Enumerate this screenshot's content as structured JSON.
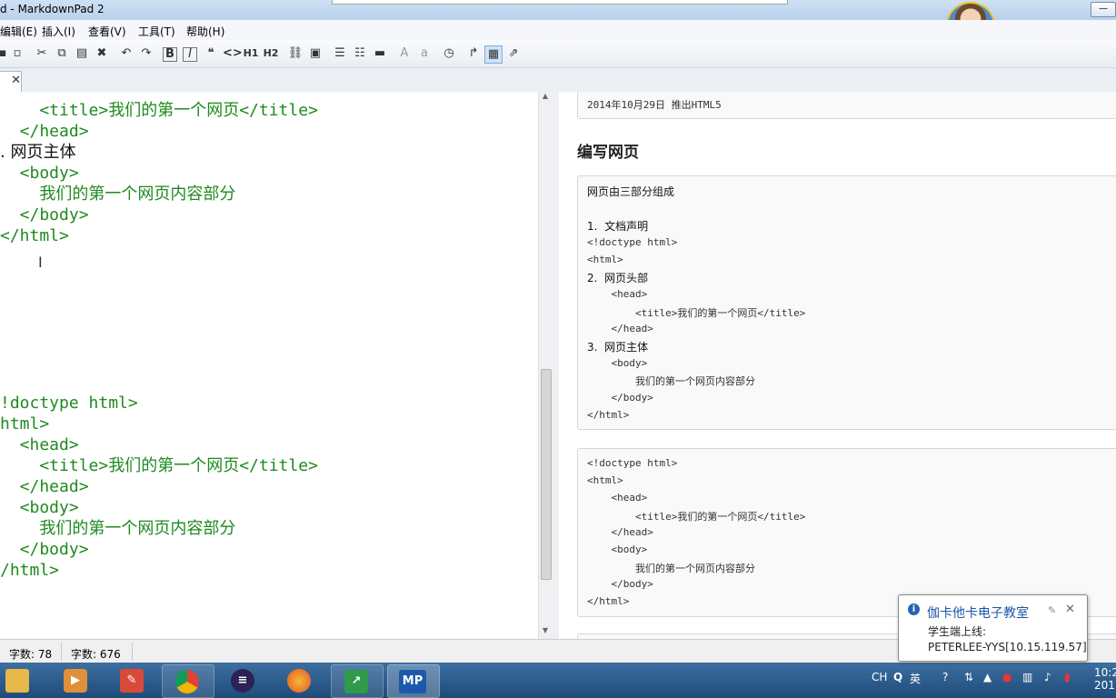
{
  "window": {
    "title": "d - MarkdownPad 2"
  },
  "menu": [
    "编辑(E)",
    "插入(I)",
    "查看(V)",
    "工具(T)",
    "帮助(H)"
  ],
  "toolbar": {
    "icons": [
      "save-icon",
      "save-all-icon",
      "cut-icon",
      "copy-icon",
      "paste-icon",
      "delete-icon",
      "undo-icon",
      "redo-icon",
      "bold-icon",
      "italic-icon",
      "quote-icon",
      "code-icon",
      "h1-icon",
      "h2-icon",
      "link-icon",
      "image-icon",
      "unordered-list-icon",
      "ordered-list-icon",
      "horizontal-rule-icon",
      "uppercase-icon",
      "lowercase-icon",
      "timestamp-icon",
      "export-icon",
      "live-preview-icon",
      "publish-icon"
    ],
    "labels": {
      "bold": "B",
      "italic": "I",
      "quote": "❝",
      "code": "<>",
      "h1": "H1",
      "h2": "H2",
      "upper": "A",
      "lower": "a"
    }
  },
  "tab": {
    "close": "✕"
  },
  "editor": {
    "lines": [
      "    <title>我们的第一个网页</title>",
      "  </head>",
      ". 网页主体",
      "  <body>",
      "    我们的第一个网页内容部分",
      "  </body>",
      "</html>",
      "!doctype html>",
      "html>",
      "  <head>",
      "    <title>我们的第一个网页</title>",
      "  </head>",
      "  <body>",
      "    我们的第一个网页内容部分",
      "  </body>",
      "/html>"
    ]
  },
  "preview": {
    "top_line": "2014年10月29日 推出HTML5",
    "heading": "编写网页",
    "block1": [
      "网页由三部分组成",
      "",
      "1.  文档声明",
      "<!doctype html>",
      "<html>",
      "2.  网页头部",
      "    <head>",
      "        <title>我们的第一个网页</title>",
      "    </head>",
      "3.  网页主体",
      "    <body>",
      "        我们的第一个网页内容部分",
      "    </body>",
      "</html>"
    ],
    "block2": [
      "<!doctype html>",
      "<html>",
      "    <head>",
      "        <title>我们的第一个网页</title>",
      "    </head>",
      "    <body>",
      "        我们的第一个网页内容部分",
      "    </body>",
      "</html>"
    ]
  },
  "status": {
    "words": "字数: 78",
    "chars": "字数: 676"
  },
  "taskbar": {
    "apps": [
      "file-explorer-icon",
      "media-player-icon",
      "notepad-icon",
      "chrome-icon",
      "eclipse-icon",
      "firefox-icon",
      "remote-desktop-icon",
      "markdownpad-icon"
    ],
    "mp_label": "MP",
    "tray": {
      "lang": "CH",
      "ime": "英",
      "clock_time": "10:2",
      "clock_date": "201"
    }
  },
  "notification": {
    "title": "伽卡他卡电子教室",
    "line1": "学生端上线:",
    "line2": "PETERLEE-YYS[10.15.119.57]",
    "close": "✕"
  },
  "ime_badge": "英"
}
